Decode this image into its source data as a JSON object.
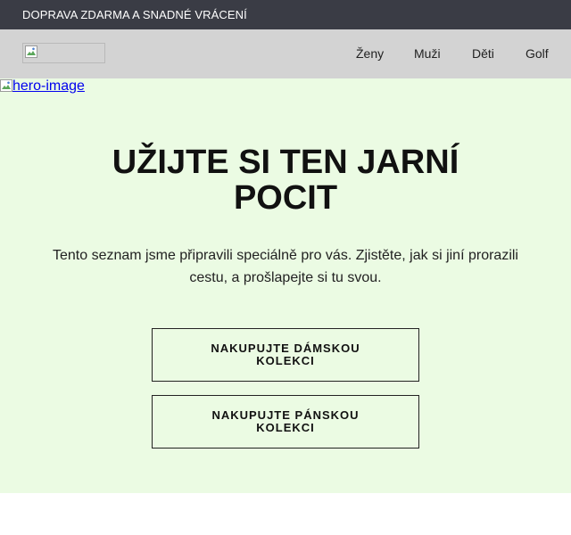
{
  "promo": {
    "text": "DOPRAVA ZDARMA A SNADNÉ VRÁCENÍ"
  },
  "nav": {
    "logo_icon": "broken-image-icon",
    "links": [
      {
        "label": "Ženy"
      },
      {
        "label": "Muži"
      },
      {
        "label": "Děti"
      },
      {
        "label": "Golf"
      }
    ]
  },
  "hero": {
    "background": "#ebfbe3",
    "image_alt": "hero-image",
    "title_line1": "UŽIJTE SI TEN JARNÍ",
    "title_line2": "POCIT",
    "description": "Tento seznam jsme připravili speciálně pro vás. Zjistěte, jak si jiní prorazili cestu, a prošlapejte si tu svou.",
    "buttons": {
      "women_label": "NAKUPUJTE DÁMSKOU KOLEKCI",
      "men_label": "NAKUPUJTE PÁNSKOU KOLEKCI"
    }
  },
  "colors": {
    "promo_bar": "#3a3c45",
    "nav_bar": "#d3d3d3",
    "hero_bg": "#ebfbe3",
    "link": "#0000ee"
  }
}
